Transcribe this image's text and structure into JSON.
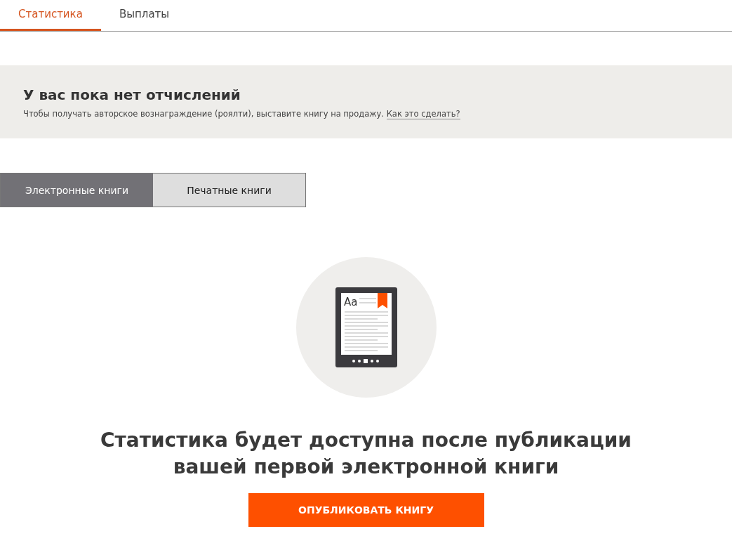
{
  "tabs": [
    {
      "label": "Статистика",
      "selected": true
    },
    {
      "label": "Выплаты",
      "selected": false
    }
  ],
  "notice": {
    "title": "У вас пока нет отчислений",
    "text": "Чтобы получать авторское вознаграждение (роялти), выставите книгу на продажу.",
    "link": "Как это сделать?"
  },
  "format_tabs": [
    {
      "label": "Электронные книги",
      "selected": true
    },
    {
      "label": "Печатные книги",
      "selected": false
    }
  ],
  "illustration": {
    "label": "Aa"
  },
  "empty_state": {
    "message": "Статистика будет доступна после публикации вашей первой электронной книги",
    "button": "ОПУБЛИКОВАТЬ КНИГУ"
  }
}
